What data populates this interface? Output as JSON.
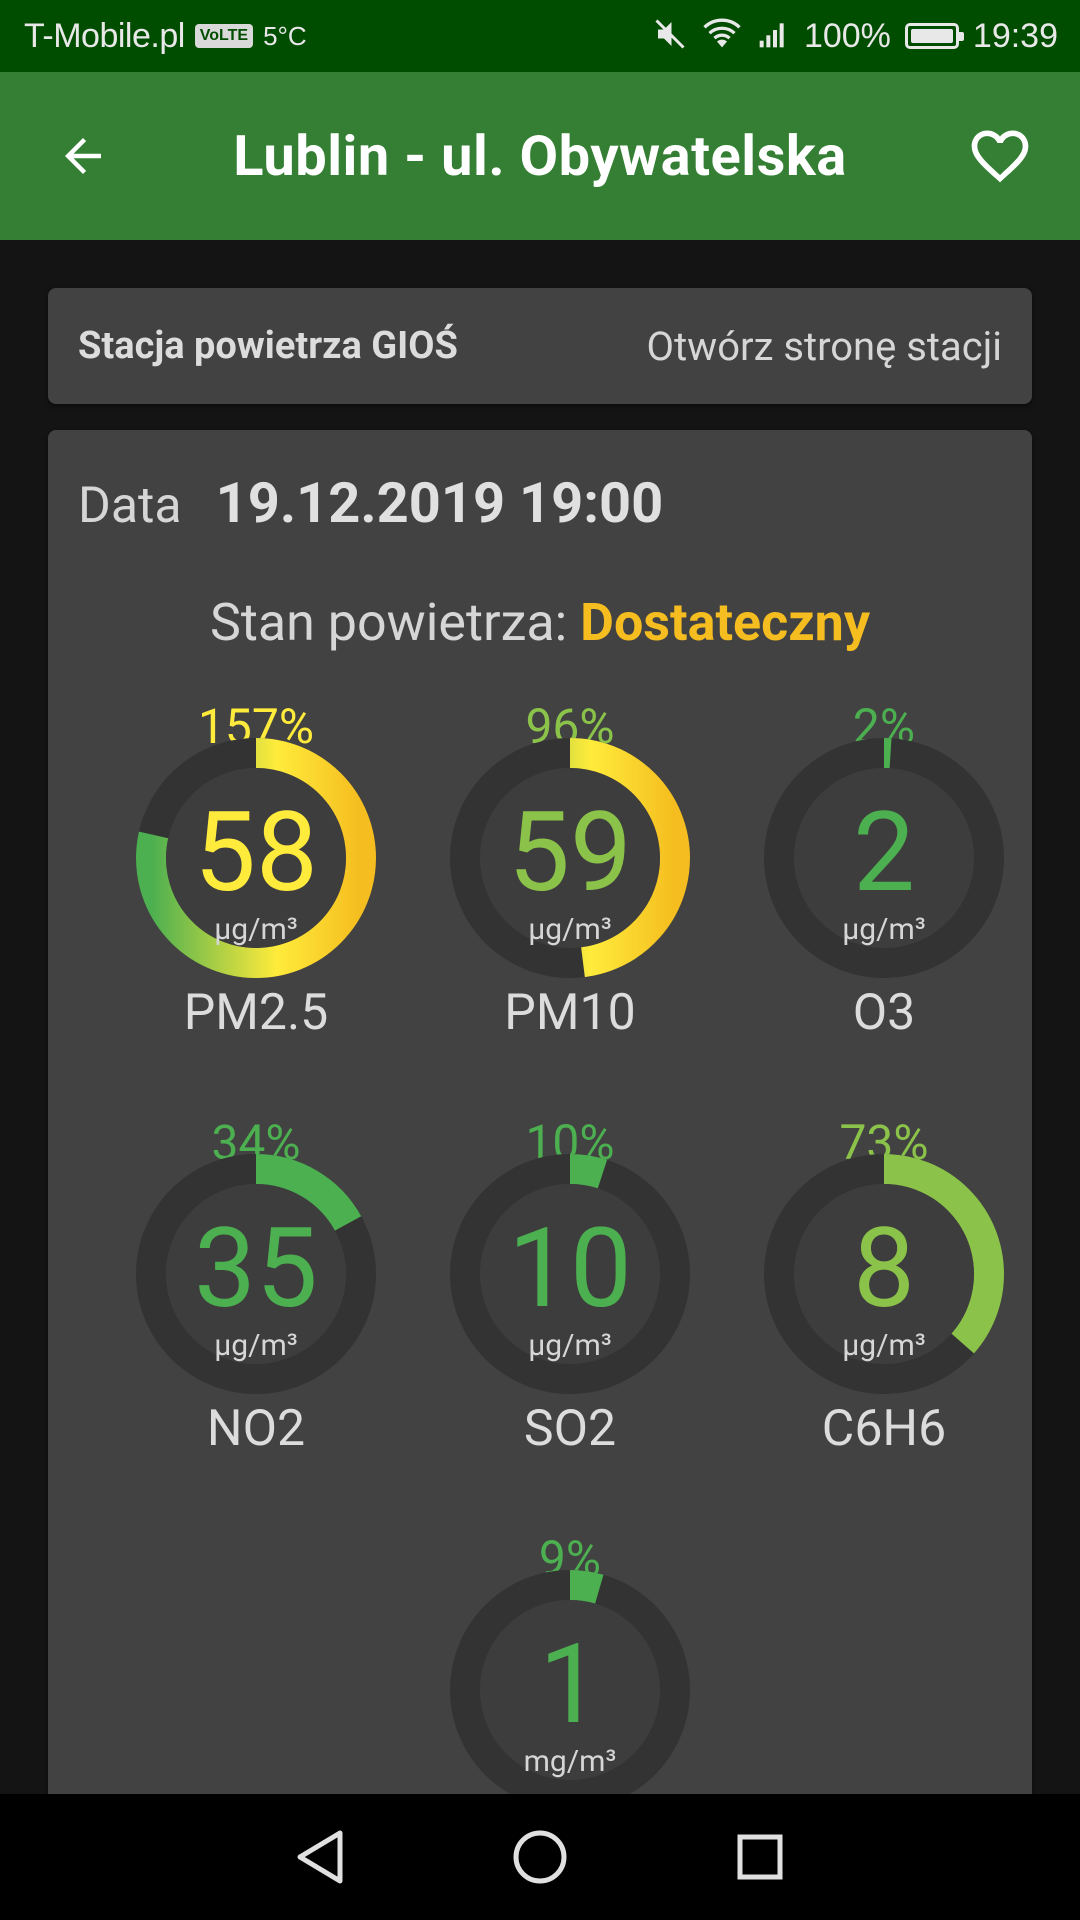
{
  "status_bar": {
    "carrier": "T-Mobile.pl",
    "volte": "VoLTE",
    "temperature": "5°C",
    "battery": "100%",
    "battery_level": 1.0,
    "time": "19:39"
  },
  "app_bar": {
    "title": "Lublin - ul. Obywatelska",
    "back_icon": "arrow-left-icon",
    "favorite_icon": "heart-outline-icon"
  },
  "station": {
    "name": "Stacja powietrza GIOŚ",
    "link": "Otwórz stronę stacji"
  },
  "measurement": {
    "date_label": "Data",
    "date_value": "19.12.2019 19:00",
    "state_label": "Stan powietrza:",
    "state_value": "Dostateczny"
  },
  "colors": {
    "green": "#4caf50",
    "light_green": "#8bc34a",
    "yellow": "#ffeb3b",
    "amber": "#f5bd1f",
    "track": "#333333"
  },
  "pollutants": [
    {
      "name": "PM2.5",
      "value": "58",
      "unit": "µg/m³",
      "percent": "157%",
      "fraction": 1.57,
      "color": "#ffeb3b"
    },
    {
      "name": "PM10",
      "value": "59",
      "unit": "µg/m³",
      "percent": "96%",
      "fraction": 0.96,
      "color": "#8bc34a"
    },
    {
      "name": "O3",
      "value": "2",
      "unit": "µg/m³",
      "percent": "2%",
      "fraction": 0.02,
      "color": "#4caf50"
    },
    {
      "name": "NO2",
      "value": "35",
      "unit": "µg/m³",
      "percent": "34%",
      "fraction": 0.34,
      "color": "#4caf50"
    },
    {
      "name": "SO2",
      "value": "10",
      "unit": "µg/m³",
      "percent": "10%",
      "fraction": 0.1,
      "color": "#4caf50"
    },
    {
      "name": "C6H6",
      "value": "8",
      "unit": "µg/m³",
      "percent": "73%",
      "fraction": 0.73,
      "color": "#8bc34a"
    },
    {
      "name": "",
      "value": "1",
      "unit": "mg/m³",
      "percent": "9%",
      "fraction": 0.09,
      "color": "#4caf50"
    }
  ],
  "nav_bar": {
    "back_icon": "triangle-back-icon",
    "home_icon": "circle-home-icon",
    "recents_icon": "square-recents-icon"
  }
}
